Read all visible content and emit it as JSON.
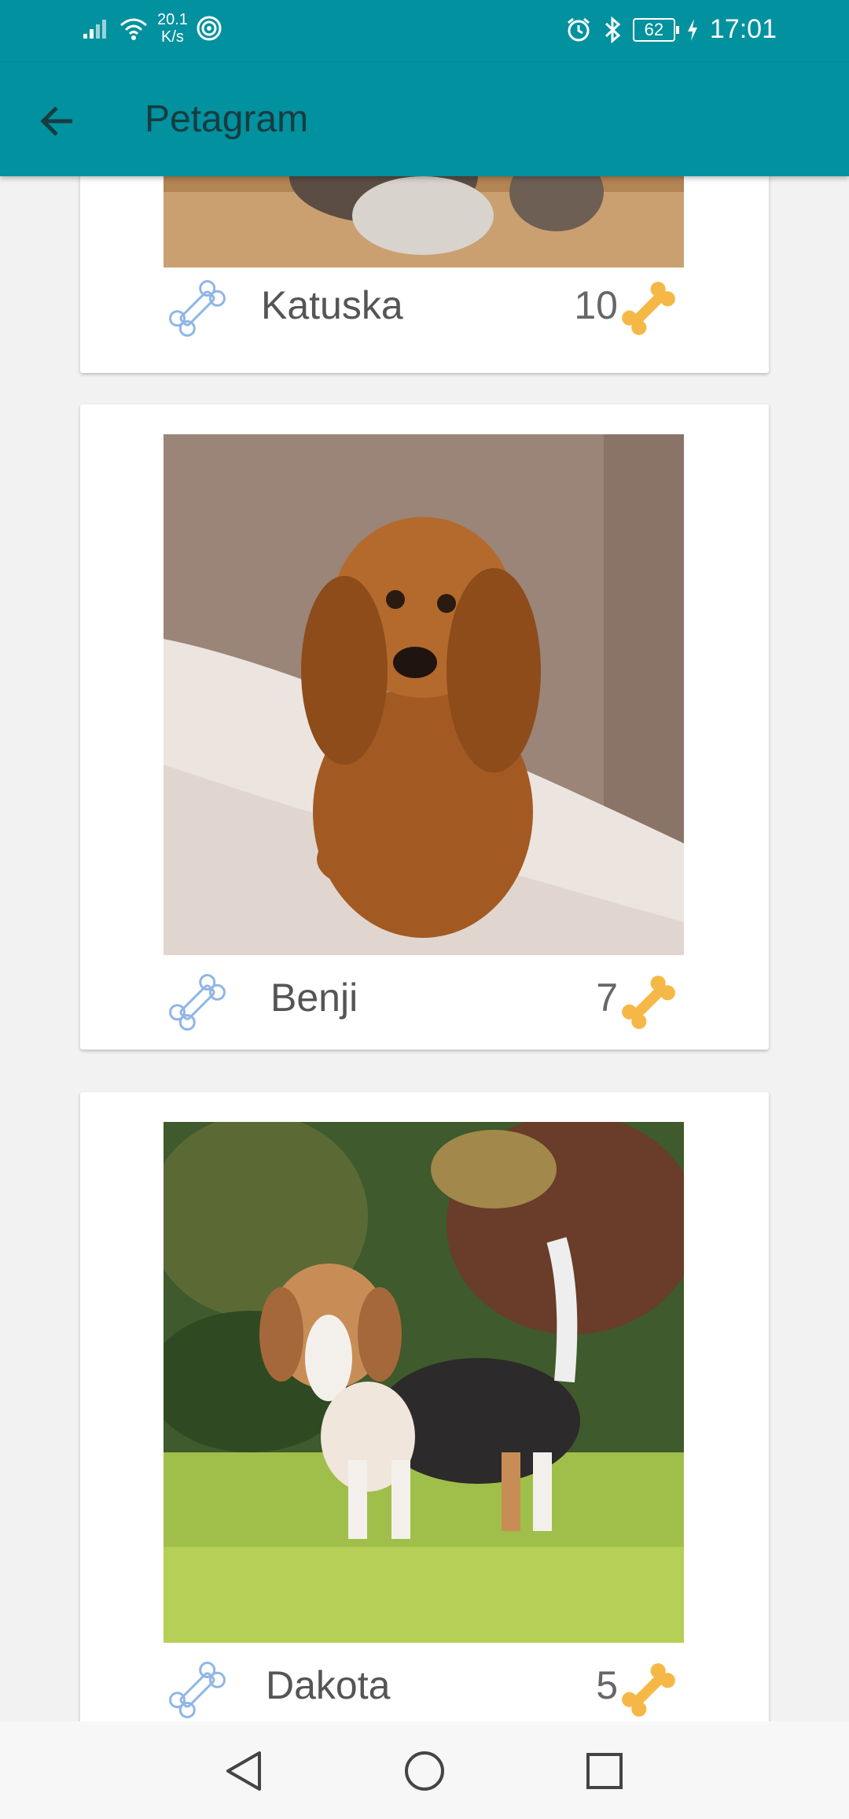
{
  "status_bar": {
    "network_speed_value": "20.1",
    "network_speed_unit": "K/s",
    "battery": "62",
    "time": "17:01"
  },
  "app_bar": {
    "title": "Petagram",
    "back_icon": "arrow-left-icon"
  },
  "pets": [
    {
      "name": "Katuska",
      "likes": "10",
      "photo": "pet-photo-partial"
    },
    {
      "name": "Benji",
      "likes": "7",
      "photo": "cocker-spaniel-puppy"
    },
    {
      "name": "Dakota",
      "likes": "5",
      "photo": "beagle-puppy"
    }
  ],
  "colors": {
    "primary": "#01919f",
    "title_text": "#173c40",
    "bone_outline": "#8fb6e6",
    "bone_filled": "#f5b847"
  },
  "nav_bar": {
    "icons": [
      "back-triangle-icon",
      "home-circle-icon",
      "recents-square-icon"
    ]
  }
}
